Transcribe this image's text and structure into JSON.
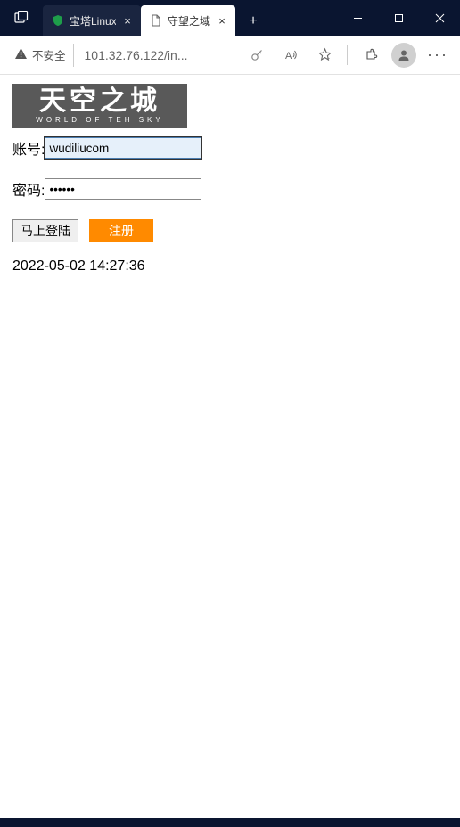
{
  "titlebar": {
    "tabs": [
      {
        "title": "宝塔Linux",
        "active": false
      },
      {
        "title": "守望之域",
        "active": true
      }
    ]
  },
  "addressbar": {
    "insecure_label": "不安全",
    "url": "101.32.76.122/in..."
  },
  "logo": {
    "main": "天空之城",
    "sub": "WORLD OF TEH SKY"
  },
  "form": {
    "username_label": "账号:",
    "username_value": "wudiliucom",
    "password_label": "密码:",
    "password_value": "••••••",
    "login_label": "马上登陆",
    "register_label": "注册"
  },
  "timestamp": "2022-05-02 14:27:36"
}
